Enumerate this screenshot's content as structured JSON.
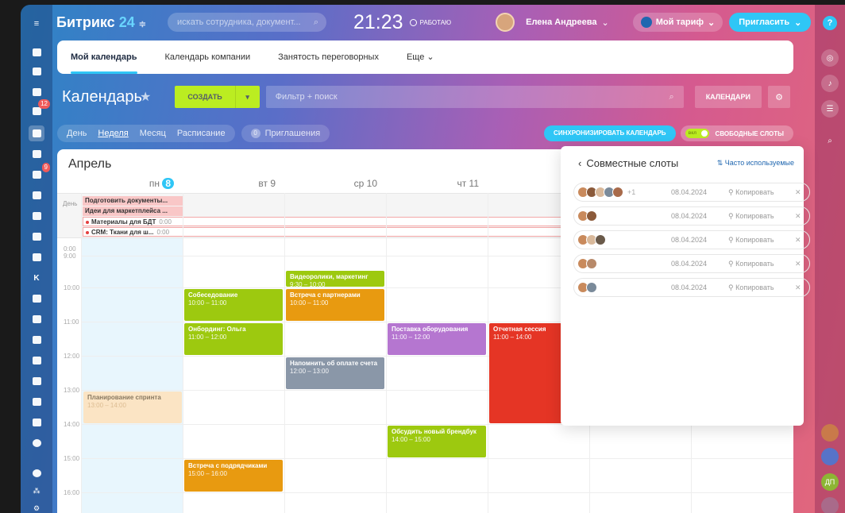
{
  "app": {
    "logo_main": "Битрикс",
    "logo_num": "24",
    "logo_suffix": "≑"
  },
  "header": {
    "search_placeholder": "искать сотрудника, документ...",
    "clock": "21:23",
    "status": "РАБОТАЮ",
    "user_name": "Елена Андреева",
    "tariff": "Мой тариф",
    "invite": "Пригласить",
    "help": "?"
  },
  "left_badges": {
    "tasks": "12",
    "filter": "9"
  },
  "tabs": [
    "Мой календарь",
    "Календарь компании",
    "Занятость переговорных",
    "Еще"
  ],
  "toolbar": {
    "title": "Календарь",
    "create": "СОЗДАТЬ",
    "filter_placeholder": "Фильтр + поиск",
    "calendars": "КАЛЕНДАРИ"
  },
  "views": {
    "items": [
      "День",
      "Неделя",
      "Месяц",
      "Расписание"
    ],
    "active": "Неделя"
  },
  "invitations": {
    "count": "0",
    "label": "Приглашения"
  },
  "sync": "СИНХРОНИЗИРОВАТЬ КАЛЕНДАРЬ",
  "free_slots": {
    "toggle": "вкл",
    "label": "СВОБОДНЫЕ СЛОТЫ"
  },
  "calendar": {
    "month": "Апрель",
    "days": [
      {
        "dow": "пн",
        "num": "8",
        "today": true
      },
      {
        "dow": "вт",
        "num": "9"
      },
      {
        "dow": "ср",
        "num": "10"
      },
      {
        "dow": "чт",
        "num": "11"
      }
    ],
    "allday_label": "День",
    "allday_events": [
      {
        "title": "Подготовить документы...",
        "style": "pink"
      },
      {
        "title": "Идеи для маркетплейса ...",
        "style": "pink"
      },
      {
        "title": "Материалы для БДТ",
        "time": "0:00",
        "style": "outline"
      },
      {
        "title": "CRM: Ткани для ш...",
        "time": "0:00",
        "style": "outline"
      }
    ],
    "time_labels": [
      "0:00",
      "9:00",
      "10:00",
      "11:00",
      "12:00",
      "13:00",
      "14:00",
      "15:00",
      "16:00"
    ],
    "events": [
      {
        "title": "Видеоролики, маркетинг",
        "time": "9:30 – 10:00",
        "color": "#9dc90f"
      },
      {
        "title": "Собеседование",
        "time": "10:00 – 11:00",
        "color": "#9dc90f"
      },
      {
        "title": "Встреча с партнерами",
        "time": "10:00 – 11:00",
        "color": "#e89a10"
      },
      {
        "title": "Онбординг: Ольга",
        "time": "11:00 – 12:00",
        "color": "#9dc90f"
      },
      {
        "title": "Поставка оборудования",
        "time": "11:00 – 12:00",
        "color": "#b576d0"
      },
      {
        "title": "Отчетная сессия",
        "time": "11:00 – 14:00",
        "color": "#e53525"
      },
      {
        "title": "Напомнить об оплате счета",
        "time": "12:00 – 13:00",
        "color": "#8a97a8"
      },
      {
        "title": "Планирование спринта",
        "time": "13:00 – 14:00",
        "color": "#fbe4c4"
      },
      {
        "title": "Обсудить новый брендбук",
        "time": "14:00 – 15:00",
        "color": "#9dc90f"
      },
      {
        "title": "Встреча с подрядчиками",
        "time": "15:00 – 16:00",
        "color": "#e89a10"
      }
    ]
  },
  "slots_panel": {
    "title": "Совместные слоты",
    "frequent": "⇅ Часто используемые",
    "rows": [
      {
        "more": "+1",
        "date": "08.04.2024",
        "copy": "Копировать"
      },
      {
        "more": "",
        "date": "08.04.2024",
        "copy": "Копировать"
      },
      {
        "more": "",
        "date": "08.04.2024",
        "copy": "Копировать"
      },
      {
        "more": "",
        "date": "08.04.2024",
        "copy": "Копировать"
      },
      {
        "more": "",
        "date": "08.04.2024",
        "copy": "Копировать"
      }
    ]
  },
  "right_initials": "ДП"
}
